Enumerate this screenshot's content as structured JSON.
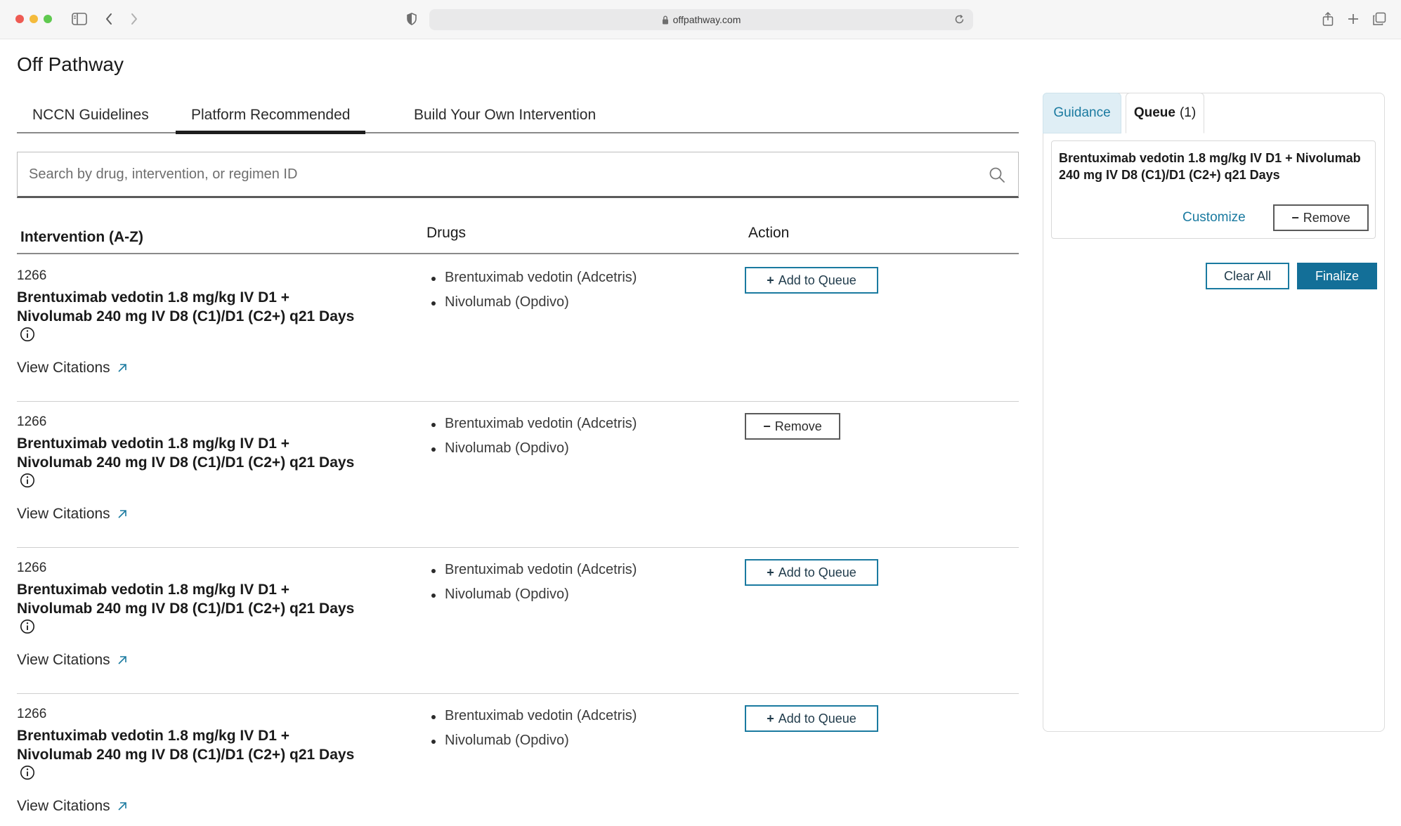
{
  "browser": {
    "url": "offpathway.com"
  },
  "page": {
    "title": "Off Pathway"
  },
  "tabs": [
    {
      "label": "NCCN Guidelines"
    },
    {
      "label": "Platform Recommended"
    },
    {
      "label": "Build Your Own Intervention"
    }
  ],
  "active_tab": "Platform Recommended",
  "search": {
    "placeholder": "Search by drug, intervention, or regimen ID",
    "value": ""
  },
  "table": {
    "headers": {
      "intervention": "Intervention (A-Z)",
      "drugs": "Drugs",
      "action": "Action"
    },
    "rows": [
      {
        "id": "1266",
        "name": "Brentuximab vedotin 1.8 mg/kg IV D1 + Nivolumab 240 mg IV D8 (C1)/D1 (C2+) q21 Days",
        "drugs": [
          "Brentuximab vedotin (Adcetris)",
          "Nivolumab (Opdivo)"
        ],
        "citations_label": "View Citations",
        "action_label": "Add to Queue",
        "action_symbol": "+"
      },
      {
        "id": "1266",
        "name": "Brentuximab vedotin 1.8 mg/kg IV D1 + Nivolumab 240 mg IV D8 (C1)/D1 (C2+) q21 Days",
        "drugs": [
          "Brentuximab vedotin (Adcetris)",
          "Nivolumab (Opdivo)"
        ],
        "citations_label": "View Citations",
        "action_label": "Remove",
        "action_symbol": "−"
      },
      {
        "id": "1266",
        "name": "Brentuximab vedotin 1.8 mg/kg IV D1 + Nivolumab 240 mg IV D8 (C1)/D1 (C2+) q21 Days",
        "drugs": [
          "Brentuximab vedotin (Adcetris)",
          "Nivolumab (Opdivo)"
        ],
        "citations_label": "View Citations",
        "action_label": "Add to Queue",
        "action_symbol": "+"
      },
      {
        "id": "1266",
        "name": "Brentuximab vedotin 1.8 mg/kg IV D1 + Nivolumab 240 mg IV D8 (C1)/D1 (C2+) q21 Days",
        "drugs": [
          "Brentuximab vedotin (Adcetris)",
          "Nivolumab (Opdivo)"
        ],
        "citations_label": "View Citations",
        "action_label": "Add to Queue",
        "action_symbol": "+"
      }
    ]
  },
  "panel": {
    "tabs": {
      "guidance": "Guidance",
      "queue": "Queue",
      "queue_count": "(1)"
    },
    "queue_items": [
      {
        "name": "Brentuximab vedotin 1.8 mg/kg IV D1 + Nivolumab 240 mg IV D8 (C1)/D1 (C2+) q21 Days",
        "customize_label": "Customize",
        "remove_label": "Remove",
        "remove_symbol": "−"
      }
    ],
    "clear_all_label": "Clear All",
    "finalize_label": "Finalize"
  },
  "colors": {
    "accent": "#1a7aa0",
    "finalize_bg": "#136f98",
    "guidance_tab_bg": "#dfeef5"
  },
  "icons": {
    "sidebar": "sidebar-toggle-icon",
    "back": "chevron-left-icon",
    "forward": "chevron-right-icon",
    "shield": "shield-icon",
    "lock": "lock-icon",
    "reload": "reload-icon",
    "share": "share-icon",
    "new_tab": "plus-icon",
    "tabs_overview": "tabs-overview-icon",
    "search": "search-icon",
    "info": "info-icon",
    "external_link": "arrow-up-right-icon"
  }
}
